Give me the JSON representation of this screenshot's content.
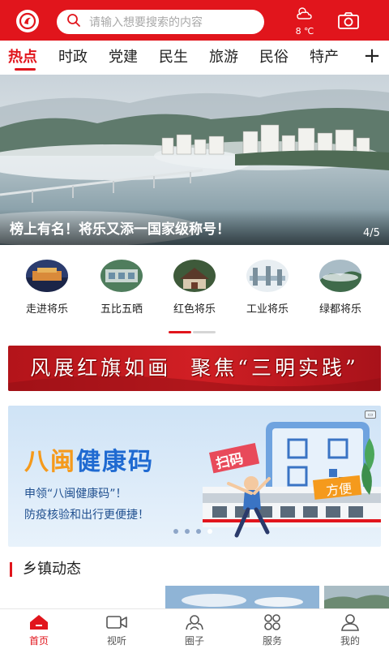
{
  "header": {
    "search_placeholder": "请输入想要搜索的内容",
    "weather_temp": "8 ℃",
    "icons": [
      "app-logo-icon",
      "search-icon",
      "weather-cloudy-icon",
      "camera-icon"
    ]
  },
  "tabs": [
    {
      "label": "热点",
      "active": true
    },
    {
      "label": "时政",
      "active": false
    },
    {
      "label": "党建",
      "active": false
    },
    {
      "label": "民生",
      "active": false
    },
    {
      "label": "旅游",
      "active": false
    },
    {
      "label": "民俗",
      "active": false
    },
    {
      "label": "特产",
      "active": false
    }
  ],
  "tab_more": "+",
  "hero": {
    "title": "榜上有名！将乐又添一国家级称号！",
    "counter": "4/5"
  },
  "quick_links": [
    {
      "label": "走进将乐"
    },
    {
      "label": "五比五晒"
    },
    {
      "label": "红色将乐"
    },
    {
      "label": "工业将乐"
    },
    {
      "label": "绿都将乐"
    }
  ],
  "slogan": {
    "text": "风展红旗如画  聚焦“三明实践”"
  },
  "ad": {
    "title_prefix": "八闽",
    "title_rest": "健康码",
    "line1": "申领“八闽健康码”！",
    "line2": "防疫核验和出行更便捷！",
    "scan_tag": "扫码",
    "convenient_tag": "方便",
    "page_count": 4,
    "active_page": 4
  },
  "section": {
    "title": "乡镇动态"
  },
  "bottom_nav": [
    {
      "label": "首页",
      "icon": "home-icon",
      "active": true
    },
    {
      "label": "视听",
      "icon": "video-icon",
      "active": false
    },
    {
      "label": "圈子",
      "icon": "circle-community-icon",
      "active": false
    },
    {
      "label": "服务",
      "icon": "services-grid-icon",
      "active": false
    },
    {
      "label": "我的",
      "icon": "profile-icon",
      "active": false
    }
  ],
  "colors": {
    "brand_red": "#e1151c",
    "ad_blue": "#1f6ad1",
    "ad_orange": "#f59a1c",
    "inactive_gray": "#555555"
  }
}
